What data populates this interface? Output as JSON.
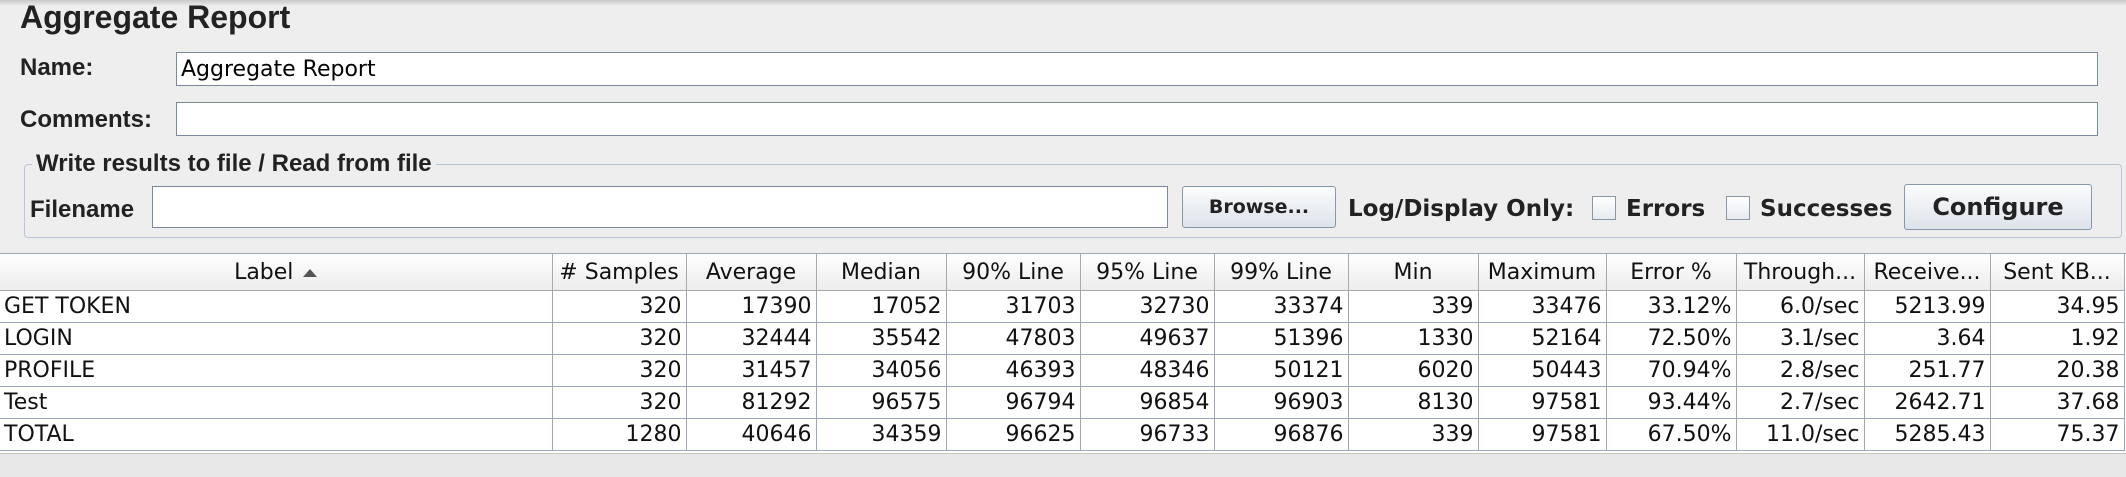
{
  "panel": {
    "title": "Aggregate Report"
  },
  "form": {
    "name_label": "Name:",
    "name_value": "Aggregate Report",
    "comments_label": "Comments:",
    "comments_value": ""
  },
  "file_section": {
    "legend": "Write results to file / Read from file",
    "filename_label": "Filename",
    "filename_value": "",
    "browse_label": "Browse...",
    "log_display_label": "Log/Display Only:",
    "errors_label": "Errors",
    "errors_checked": false,
    "successes_label": "Successes",
    "successes_checked": false,
    "configure_label": "Configure"
  },
  "table": {
    "columns": [
      "Label",
      "# Samples",
      "Average",
      "Median",
      "90% Line",
      "95% Line",
      "99% Line",
      "Min",
      "Maximum",
      "Error %",
      "Through...",
      "Receive...",
      "Sent KB..."
    ],
    "sort_column": "Label",
    "sort_direction": "ascending",
    "rows": [
      [
        "GET TOKEN",
        "320",
        "17390",
        "17052",
        "31703",
        "32730",
        "33374",
        "339",
        "33476",
        "33.12%",
        "6.0/sec",
        "5213.99",
        "34.95"
      ],
      [
        "LOGIN",
        "320",
        "32444",
        "35542",
        "47803",
        "49637",
        "51396",
        "1330",
        "52164",
        "72.50%",
        "3.1/sec",
        "3.64",
        "1.92"
      ],
      [
        "PROFILE",
        "320",
        "31457",
        "34056",
        "46393",
        "48346",
        "50121",
        "6020",
        "50443",
        "70.94%",
        "2.8/sec",
        "251.77",
        "20.38"
      ],
      [
        "Test",
        "320",
        "81292",
        "96575",
        "96794",
        "96854",
        "96903",
        "8130",
        "97581",
        "93.44%",
        "2.7/sec",
        "2642.71",
        "37.68"
      ],
      [
        "TOTAL",
        "1280",
        "40646",
        "34359",
        "96625",
        "96733",
        "96876",
        "339",
        "97581",
        "67.50%",
        "11.0/sec",
        "5285.43",
        "75.37"
      ]
    ]
  }
}
